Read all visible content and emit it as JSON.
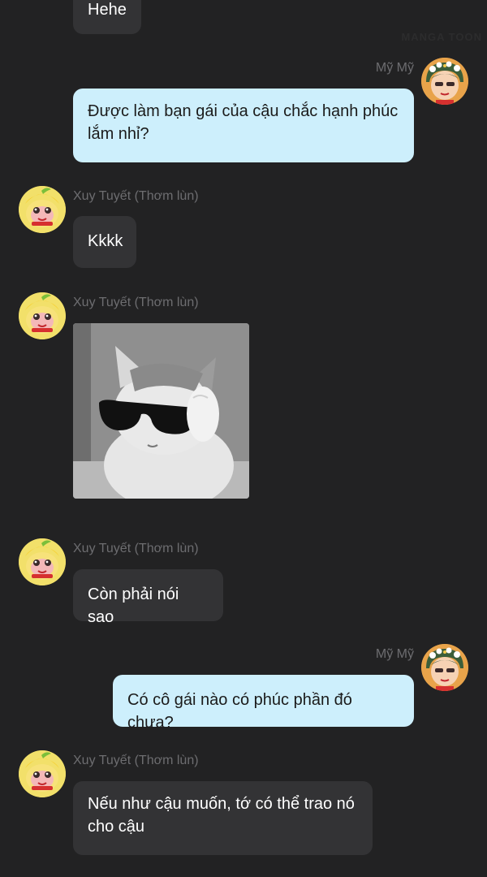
{
  "watermark": "MANGA TOON",
  "messages": {
    "m0": {
      "text": "Hehe"
    },
    "m1": {
      "sender": "Mỹ Mỹ",
      "text": "Được làm bạn gái của cậu chắc hạnh phúc lắm nhỉ?"
    },
    "m2": {
      "sender": "Xuy Tuyết (Thơm lùn)",
      "text": "Kkkk"
    },
    "m3": {
      "sender": "Xuy Tuyết (Thơm lùn)",
      "image": "cat-with-sunglasses"
    },
    "m4": {
      "sender": "Xuy Tuyết (Thơm lùn)",
      "text": "Còn phải nói sao"
    },
    "m5": {
      "sender": "Mỹ Mỹ",
      "text": "Có cô gái nào có phúc phần đó chưa?"
    },
    "m6": {
      "sender": "Xuy Tuyết (Thơm lùn)",
      "text": "Nếu như cậu muốn, tớ có thể trao nó cho cậu"
    }
  },
  "colors": {
    "background": "#222223",
    "incoming_bubble": "#333335",
    "outgoing_bubble": "#cdeffc",
    "sender_name": "#6d6d70"
  }
}
